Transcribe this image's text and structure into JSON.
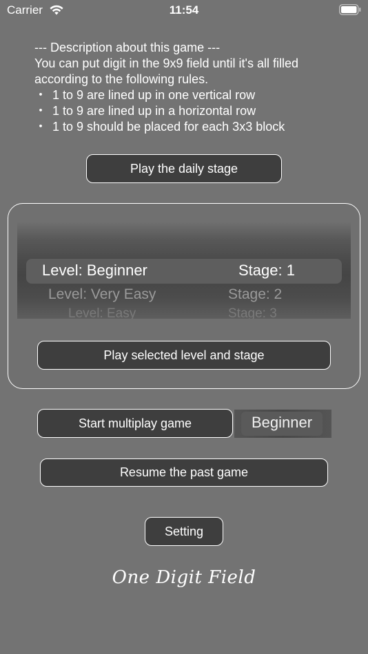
{
  "status_bar": {
    "carrier": "Carrier",
    "time": "11:54",
    "wifi_icon": "wifi-icon",
    "battery_icon": "battery-icon"
  },
  "description": {
    "lines": [
      "--- Description about this game ---",
      "You can put digit in the 9x9 field until it's all filled",
      "according to the following rules."
    ],
    "bullet": "・",
    "rules": [
      "1 to 9 are lined up in one vertical row",
      "1 to 9 are lined up in a horizontal row",
      "1 to 9 should be placed for each 3x3 block"
    ]
  },
  "buttons": {
    "daily_stage": "Play the daily stage",
    "play_selected": "Play selected level and stage",
    "multiplay": "Start multiplay game",
    "resume": "Resume the past game",
    "setting": "Setting"
  },
  "picker": {
    "rows": [
      {
        "level": "Level: Beginner",
        "stage": "Stage: 1"
      },
      {
        "level": "Level: Very Easy",
        "stage": "Stage: 2"
      },
      {
        "level": "Level: Easy",
        "stage": "Stage: 3"
      }
    ]
  },
  "multiplay_level": "Beginner",
  "logo": "One Digit Field",
  "colors": {
    "background": "#737373",
    "button_fill": "#3e3e3e",
    "button_border": "#ffffff"
  }
}
